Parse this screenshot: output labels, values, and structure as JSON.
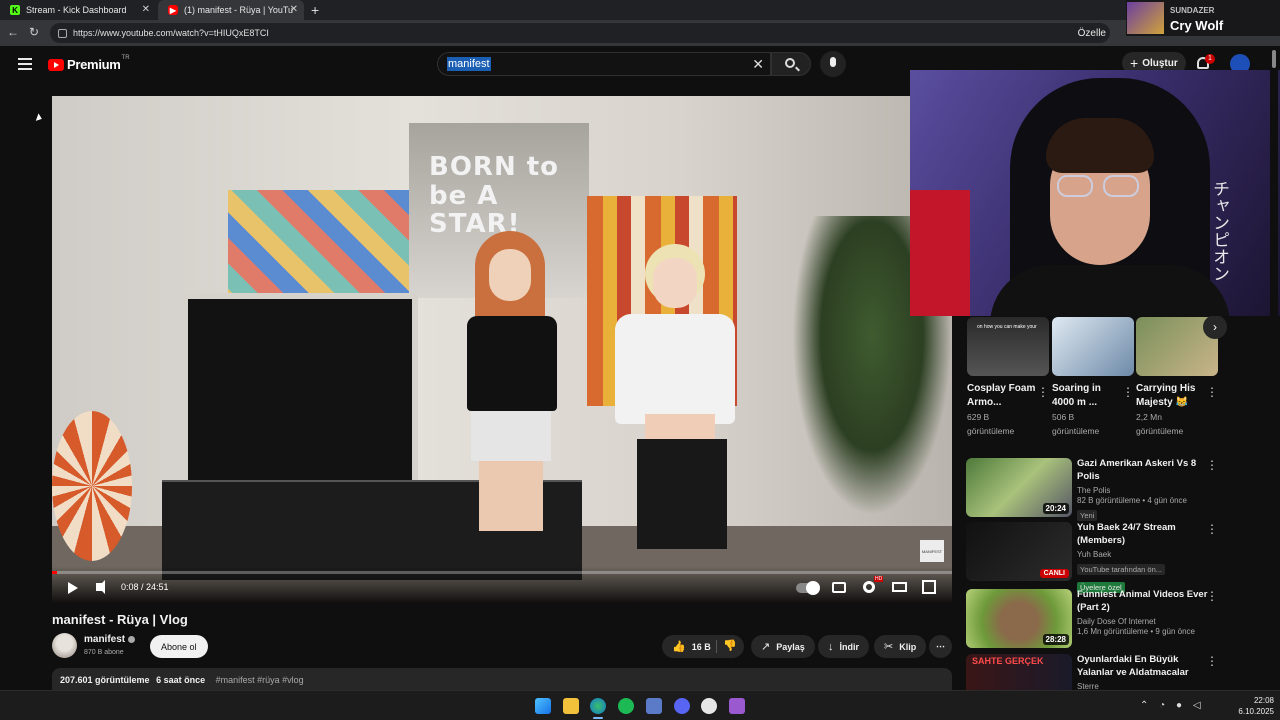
{
  "browser": {
    "tabs": [
      {
        "label": "Stream - Kick Dashboard",
        "favicon": "kick-icon"
      },
      {
        "label": "(1) manifest - Rüya | YouTu",
        "favicon": "youtube-icon"
      }
    ],
    "url": "https://www.youtube.com/watch?v=tHIUQxE8TCI",
    "customize_label": "Özelle"
  },
  "header": {
    "logo_text": "Premium",
    "logo_region": "TR",
    "search_query": "manifest",
    "create_label": "Oluştur",
    "notification_count": "1"
  },
  "player": {
    "time": "0:08 / 24:51",
    "progress_fraction": 0.005,
    "sign_text": "BORN to be A STAR!",
    "watermark": "MANIFEST",
    "hd_badge": "HD"
  },
  "video": {
    "title": "manifest - Rüya | Vlog",
    "channel": "manifest",
    "subscribers": "870 B abone",
    "subscribe_label": "Abone ol",
    "likes": "16 B",
    "share_label": "Paylaş",
    "download_label": "İndir",
    "clip_label": "Klip",
    "views": "207.601 görüntüleme",
    "age": "6 saat önce",
    "tags": "#manifest #rüya #vlog"
  },
  "shorts": [
    {
      "title": "Cosplay Foam Armo...",
      "views": "629 B",
      "views_label": "görüntüleme",
      "thumb_caption": "on how you can make your"
    },
    {
      "title": "Soaring in 4000 m ...",
      "views": "506 B",
      "views_label": "görüntüleme"
    },
    {
      "title": "Carrying His Majesty 😹",
      "views": "2,2 Mn",
      "views_label": "görüntüleme"
    }
  ],
  "recommendations": [
    {
      "title": "Gazi Amerikan Askeri Vs 8 Polis",
      "channel": "The Polis",
      "meta": "82 B görüntüleme • 4 gün önce",
      "badge": "Yeni",
      "duration": "20:24"
    },
    {
      "title": "Yuh Baek 24/7 Stream (Members)",
      "channel": "Yuh Baek",
      "meta": "YouTube tarafından ön...",
      "badge": "Üyelere özel",
      "live": "CANLI"
    },
    {
      "title": "Funniest Animal Videos Ever (Part 2)",
      "channel": "Daily Dose Of Internet",
      "meta": "1,6 Mn görüntüleme • 9 gün önce",
      "duration": "28:28"
    },
    {
      "title": "Oyunlardaki En Büyük Yalanlar ve Aldatmacalar",
      "channel": "Sterre",
      "thumb_caption": "SAHTE   GERÇEK"
    }
  ],
  "webcam": {
    "side_text": "チャンピオン"
  },
  "streamer_badge": {
    "label": "SUNDAZER",
    "name": "Cry Wolf"
  },
  "taskbar": {
    "time": "22:08",
    "date": "6.10.2025"
  },
  "colors": {
    "youtube_red": "#ff0000",
    "background": "#0f0f0f",
    "kick_green": "#53fc18"
  }
}
